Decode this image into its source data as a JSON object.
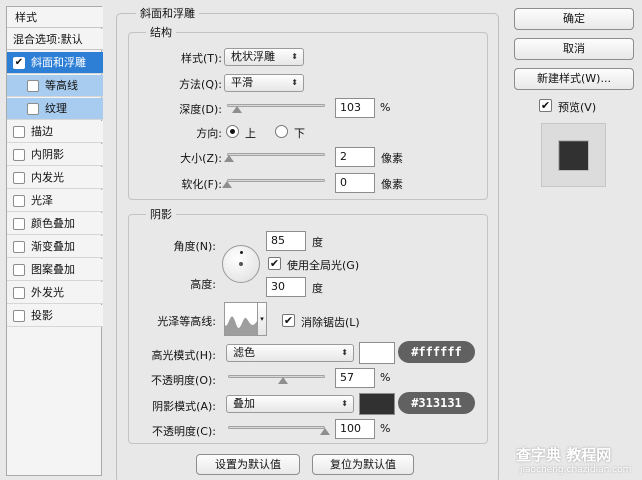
{
  "left_panel": {
    "header": "样式",
    "blend_options": "混合选项:默认",
    "items": [
      {
        "label": "斜面和浮雕",
        "checked": true,
        "state": "active"
      },
      {
        "label": "等高线",
        "checked": false,
        "state": "sub"
      },
      {
        "label": "纹理",
        "checked": false,
        "state": "sub"
      },
      {
        "label": "描边",
        "checked": false
      },
      {
        "label": "内阴影",
        "checked": false
      },
      {
        "label": "内发光",
        "checked": false
      },
      {
        "label": "光泽",
        "checked": false
      },
      {
        "label": "颜色叠加",
        "checked": false
      },
      {
        "label": "渐变叠加",
        "checked": false
      },
      {
        "label": "图案叠加",
        "checked": false
      },
      {
        "label": "外发光",
        "checked": false
      },
      {
        "label": "投影",
        "checked": false
      }
    ]
  },
  "bevel": {
    "title": "斜面和浮雕",
    "structure": {
      "title": "结构",
      "style_label": "样式(T):",
      "style_value": "枕状浮雕",
      "technique_label": "方法(Q):",
      "technique_value": "平滑",
      "depth_label": "深度(D):",
      "depth_value": "103",
      "depth_unit": "%",
      "depth_level": 0.103,
      "direction_label": "方向:",
      "direction_up": "上",
      "direction_down": "下",
      "size_label": "大小(Z):",
      "size_value": "2",
      "size_unit": "像素",
      "size_level": 0.02,
      "soften_label": "软化(F):",
      "soften_value": "0",
      "soften_unit": "像素",
      "soften_level": 0.0
    },
    "shading": {
      "title": "阴影",
      "angle_label": "角度(N):",
      "angle_value": "85",
      "angle_unit": "度",
      "global_light_label": "使用全局光(G)",
      "altitude_label": "高度:",
      "altitude_value": "30",
      "altitude_unit": "度",
      "gloss_contour_label": "光泽等高线:",
      "anti_aliased_label": "消除锯齿(L)",
      "highlight_mode_label": "高光模式(H):",
      "highlight_mode_value": "滤色",
      "highlight_color": "#ffffff",
      "highlight_hex": "#ffffff",
      "highlight_opacity_label": "不透明度(O):",
      "highlight_opacity_value": "57",
      "highlight_opacity_unit": "%",
      "highlight_opacity_level": 0.57,
      "shadow_mode_label": "阴影模式(A):",
      "shadow_mode_value": "叠加",
      "shadow_color": "#313131",
      "shadow_hex": "#313131",
      "shadow_opacity_label": "不透明度(C):",
      "shadow_opacity_value": "100",
      "shadow_opacity_unit": "%",
      "shadow_opacity_level": 1.0
    },
    "make_default": "设置为默认值",
    "reset_default": "复位为默认值"
  },
  "right_panel": {
    "ok": "确定",
    "cancel": "取消",
    "new_style": "新建样式(W)...",
    "preview_label": "预览(V)",
    "preview_checked": true
  },
  "watermark": {
    "site": "查字典 教程网",
    "url": "jiaocheng.chazidian.com"
  },
  "colors": {
    "active": "#2d7fd6",
    "sub": "#a8ccef",
    "pill": "#616161"
  }
}
